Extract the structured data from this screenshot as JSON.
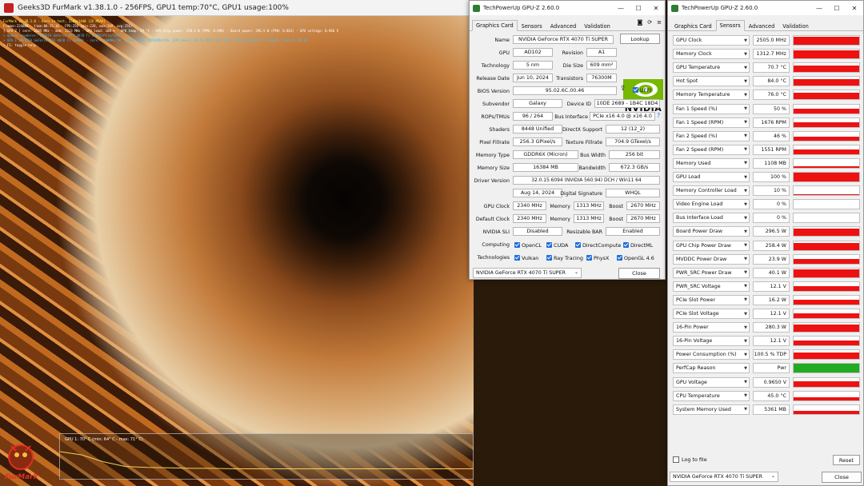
{
  "furmark": {
    "title": "Geeks3D FurMark v1.38.1.0 - 256FPS, GPU1 temp:70°C, GPU1 usage:100%",
    "overlay": [
      {
        "text": "FurMark v1.38.1.0 - Burn-in test, 2560x1440 (2X MSAA)",
        "color": "#ffff40"
      },
      {
        "text": "Frames:224808 - time:00:15:10 - FPS:256 (min:228, max:269, avg:256)",
        "color": "#ffffff"
      },
      {
        "text": "[ GPU-Z ] core: 2505 MHz - mem: 1313 MHz - GPU load: 100 % - GPU temp: 70 °C - GPU chip power: 258.4 W (PPW: 0.990) - Board power: 296.5 W (PPW: 0.863) - GPU voltage: 0.966 V",
        "color": "#ffffff"
      },
      {
        "text": "> OpenGL renderer: NVIDIA GeForce RTX 4070 Ti SUPER/PCIe/SSE2",
        "color": "#40c0ff"
      },
      {
        "text": "> GPU 1 (NVIDIA GeForce RTX 4070 Ti SUPER) - core: 2490MHz/70 °C/99%, mem: 10501MHz/8%, GPU power: 98.2% TDP, fan: 50%, limits:[power:1, temp:0, volt:0, OV:0]",
        "color": "#40c0ff"
      },
      {
        "text": "- F1: toggle help",
        "color": "#ffffff"
      }
    ],
    "graph_label": "GPU 1: 70° C (min: 64° C - max: 71° C)",
    "graph_series": [
      0.62,
      0.55,
      0.4,
      0.3,
      0.28,
      0.27,
      0.26,
      0.26,
      0.25,
      0.25,
      0.25,
      0.25,
      0.25,
      0.25,
      0.25,
      0.25,
      0.25,
      0.25,
      0.25,
      0.25
    ],
    "logo_text": "FurMark"
  },
  "gpuz1": {
    "title": "TechPowerUp GPU-Z 2.60.0",
    "tabs": [
      "Graphics Card",
      "Sensors",
      "Advanced",
      "Validation"
    ],
    "name": "NVIDIA GeForce RTX 4070 Ti SUPER",
    "lookup": "Lookup",
    "gpu": "AD102",
    "revision": "A1",
    "technology": "5 nm",
    "die_size": "609 mm²",
    "release_date": "Jun 10, 2024",
    "transistors": "76300M",
    "bios": "95.02.6C.00.46",
    "uefi": "UEFI",
    "subvendor": "Galaxy",
    "device_id": "10DE 2689 - 1B4C 18D4",
    "rops": "96 / 264",
    "bus_interface": "PCIe x16 4.0 @ x16 4.0",
    "shaders": "8448 Unified",
    "directx": "12 (12_2)",
    "pixel_fillrate": "256.3 GPixel/s",
    "texture_fillrate": "704.9 GTexel/s",
    "memory_type": "GDDR6X (Micron)",
    "bus_width": "256 bit",
    "memory_size": "16384 MB",
    "bandwidth": "672.3 GB/s",
    "driver_version": "32.0.15.6094 (NVIDIA 560.94) DCH / Win11 64",
    "driver_date": "Aug 14, 2024",
    "digital_signature": "WHQL",
    "gpu_clock": "2340 MHz",
    "memory_clock": "1313 MHz",
    "boost_clock": "2670 MHz",
    "def_gpu_clock": "2340 MHz",
    "def_memory_clock": "1313 MHz",
    "def_boost_clock": "2670 MHz",
    "sli": "Disabled",
    "resizable_bar": "Enabled",
    "labels": {
      "name": "Name",
      "gpu": "GPU",
      "revision": "Revision",
      "technology": "Technology",
      "die_size": "Die Size",
      "release_date": "Release Date",
      "transistors": "Transistors",
      "bios": "BIOS Version",
      "subvendor": "Subvendor",
      "device_id": "Device ID",
      "rops": "ROPs/TMUs",
      "bus_interface": "Bus Interface",
      "shaders": "Shaders",
      "directx": "DirectX Support",
      "pixel": "Pixel Fillrate",
      "texture": "Texture Fillrate",
      "memtype": "Memory Type",
      "buswidth": "Bus Width",
      "memsize": "Memory Size",
      "bandwidth": "Bandwidth",
      "driver": "Driver Version",
      "driverdate": "Driver Date",
      "digsig": "Digital Signature",
      "gpuclock": "GPU Clock",
      "memory": "Memory",
      "boost": "Boost",
      "defclock": "Default Clock",
      "sli": "NVIDIA SLI",
      "rebar": "Resizable BAR",
      "computing": "Computing",
      "technologies": "Technologies"
    },
    "computing": [
      "OpenCL",
      "CUDA",
      "DirectCompute",
      "DirectML"
    ],
    "technologies": [
      "Vulkan",
      "Ray Tracing",
      "PhysX",
      "OpenGL 4.6"
    ],
    "selected_gpu": "NVIDIA GeForce RTX 4070 Ti SUPER",
    "close": "Close",
    "help": "?",
    "logo_text": "NVIDIA"
  },
  "gpuz2": {
    "title": "TechPowerUp GPU-Z 2.60.0",
    "tabs": [
      "Graphics Card",
      "Sensors",
      "Advanced",
      "Validation"
    ],
    "sensors": [
      {
        "name": "GPU Clock",
        "value": "2505.0 MHz",
        "level": 0.9
      },
      {
        "name": "Memory Clock",
        "value": "1312.7 MHz",
        "level": 0.9
      },
      {
        "name": "GPU Temperature",
        "value": "70.7 °C",
        "level": 0.75
      },
      {
        "name": "Hot Spot",
        "value": "84.0 °C",
        "level": 0.8
      },
      {
        "name": "Memory Temperature",
        "value": "76.0 °C",
        "level": 0.75
      },
      {
        "name": "Fan 1 Speed (%)",
        "value": "50 %",
        "level": 0.5
      },
      {
        "name": "Fan 1 Speed (RPM)",
        "value": "1676 RPM",
        "level": 0.55
      },
      {
        "name": "Fan 2 Speed (%)",
        "value": "46 %",
        "level": 0.45
      },
      {
        "name": "Fan 2 Speed (RPM)",
        "value": "1551 RPM",
        "level": 0.5
      },
      {
        "name": "Memory Used",
        "value": "1108 MB",
        "level": 0.15
      },
      {
        "name": "GPU Load",
        "value": "100 %",
        "level": 1.0
      },
      {
        "name": "Memory Controller Load",
        "value": "10 %",
        "level": 0.1
      },
      {
        "name": "Video Engine Load",
        "value": "0 %",
        "level": 0
      },
      {
        "name": "Bus Interface Load",
        "value": "0 %",
        "level": 0
      },
      {
        "name": "Board Power Draw",
        "value": "296.5 W",
        "level": 0.85
      },
      {
        "name": "GPU Chip Power Draw",
        "value": "258.4 W",
        "level": 0.8
      },
      {
        "name": "MVDDC Power Draw",
        "value": "23.9 W",
        "level": 0.55
      },
      {
        "name": "PWR_SRC Power Draw",
        "value": "40.1 W",
        "level": 0.85
      },
      {
        "name": "PWR_SRC Voltage",
        "value": "12.1 V",
        "level": 0.55
      },
      {
        "name": "PCIe Slot Power",
        "value": "16.2 W",
        "level": 0.5
      },
      {
        "name": "PCIe Slot Voltage",
        "value": "12.1 V",
        "level": 0.55
      },
      {
        "name": "16-Pin Power",
        "value": "280.3 W",
        "level": 0.85
      },
      {
        "name": "16-Pin Voltage",
        "value": "12.1 V",
        "level": 0.55
      },
      {
        "name": "Power Consumption (%)",
        "value": "100.5 % TDP",
        "level": 0.8
      },
      {
        "name": "PerfCap Reason",
        "value": "Pwr",
        "level": 1.0,
        "color": "#22aa22"
      },
      {
        "name": "GPU Voltage",
        "value": "0.9650 V",
        "level": 0.6
      },
      {
        "name": "CPU Temperature",
        "value": "45.0 °C",
        "level": 0.35
      },
      {
        "name": "System Memory Used",
        "value": "5361 MB",
        "level": 0.3
      }
    ],
    "log_to_file": "Log to file",
    "reset": "Reset",
    "selected_gpu": "NVIDIA GeForce RTX 4070 Ti SUPER",
    "close": "Close"
  },
  "colors": {
    "sensor_bar": "#ee1111",
    "perfcap": "#22aa22",
    "checkbox": "#1e6fd9",
    "nvidia_green": "#76b900"
  }
}
